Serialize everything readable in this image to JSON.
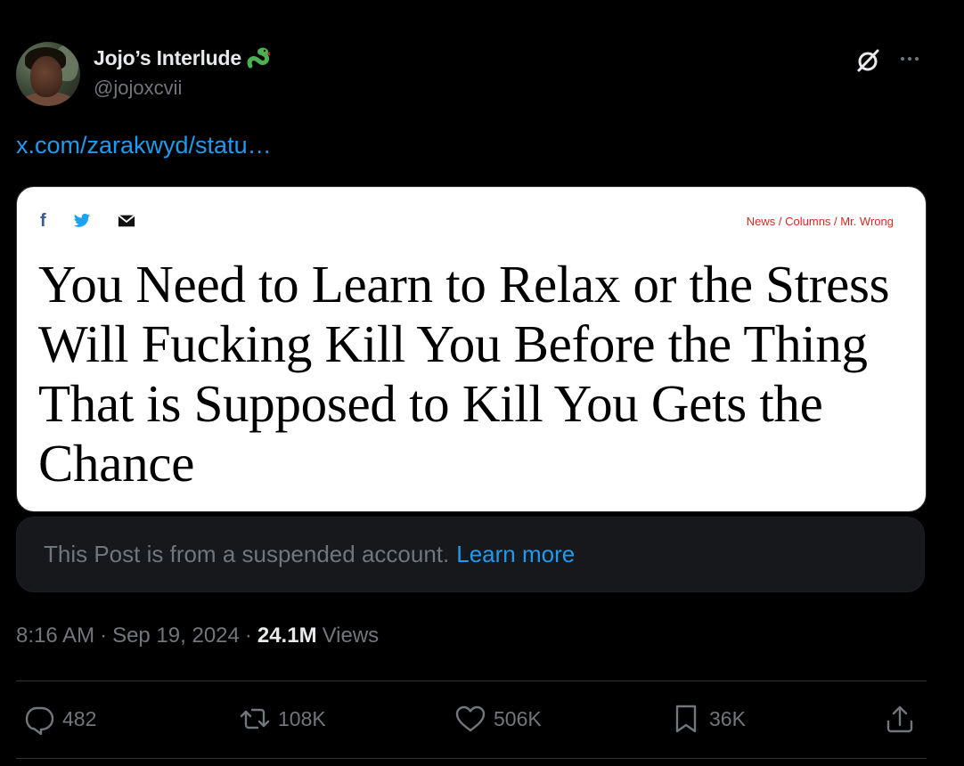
{
  "author": {
    "display_name": "Jojo’s Interlude",
    "handle": "@jojoxcvii",
    "badge_icon": "snake-emoji-icon"
  },
  "header_icons": [
    "grok-icon",
    "more-icon"
  ],
  "post": {
    "link_text": "x.com/zarakwyd/statu…"
  },
  "embedded_image": {
    "share_icons": [
      "facebook-icon",
      "twitter-icon",
      "mail-icon"
    ],
    "breadcrumb": "News / Columns / Mr. Wrong",
    "headline": "You Need to Learn to Relax or the Stress Will Fucking Kill You Before the Thing That is Supposed to Kill You Gets the Chance"
  },
  "notice": {
    "text": "This Post is from a suspended account.",
    "link": "Learn more"
  },
  "meta": {
    "time": "8:16 AM",
    "separator": "·",
    "date": "Sep 19, 2024",
    "views_count": "24.1M",
    "views_label": "Views"
  },
  "actions": {
    "replies": "482",
    "reposts": "108K",
    "likes": "506K",
    "bookmarks": "36K"
  },
  "colors": {
    "background": "#000000",
    "link": "#1d9bf0",
    "muted": "#71767b",
    "text": "#e7e9ea",
    "breadcrumb": "#d6291f"
  }
}
